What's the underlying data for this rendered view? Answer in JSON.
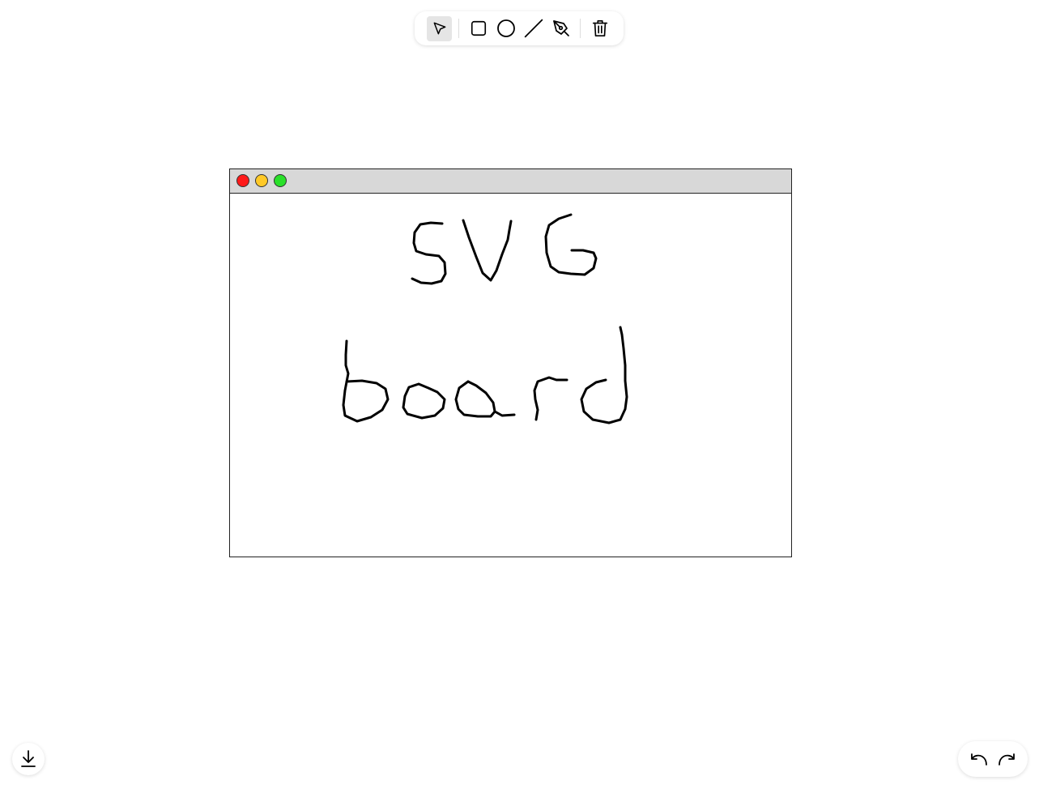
{
  "colors": {
    "toolbar_active_bg": "#e5e5e5",
    "stroke": "#000000",
    "frame_titlebar": "#d8d8d8",
    "dot_red": "#ff1a1a",
    "dot_yellow": "#ffc928",
    "dot_green": "#2ae02a"
  },
  "toolbar": {
    "tools": [
      {
        "name": "select",
        "icon": "cursor-arrow-icon",
        "active": true
      },
      {
        "name": "rectangle",
        "icon": "square-icon",
        "active": false
      },
      {
        "name": "circle",
        "icon": "circle-icon",
        "active": false
      },
      {
        "name": "line",
        "icon": "line-icon",
        "active": false
      },
      {
        "name": "pen",
        "icon": "pen-icon",
        "active": false
      }
    ],
    "actions": [
      {
        "name": "clear",
        "icon": "trash-icon"
      }
    ]
  },
  "canvas": {
    "window_controls": [
      "close",
      "minimize",
      "maximize"
    ],
    "handwritten_text": [
      "SVG",
      "board"
    ]
  },
  "footer": {
    "download_icon": "download-icon",
    "undo_icon": "undo-icon",
    "redo_icon": "redo-icon"
  }
}
